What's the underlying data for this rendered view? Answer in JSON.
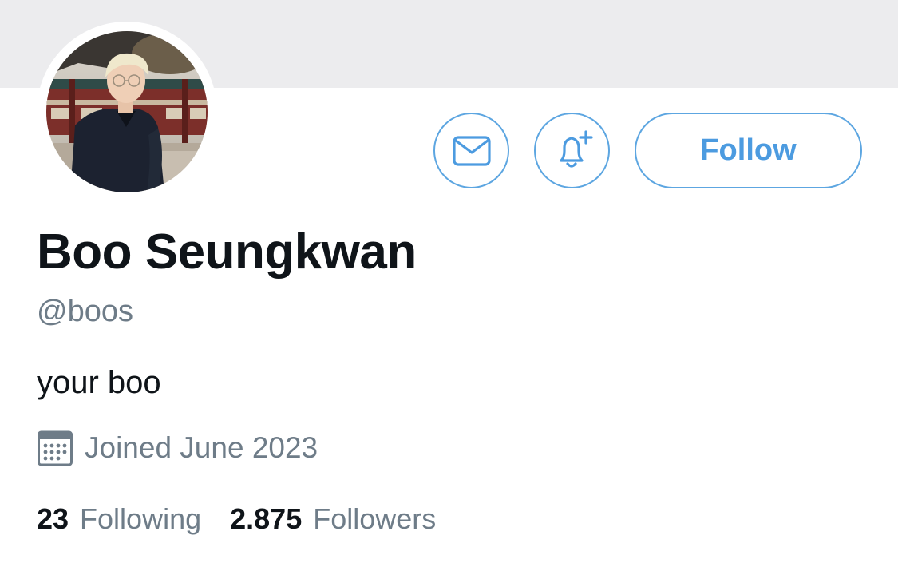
{
  "profile": {
    "display_name": "Boo Seungkwan",
    "handle": "@boos",
    "bio": "your boo",
    "joined": "Joined June 2023"
  },
  "actions": {
    "message_icon": "envelope-icon",
    "notify_icon": "bell-plus-icon",
    "follow_label": "Follow"
  },
  "stats": {
    "following_count": "23",
    "following_label": "Following",
    "followers_count": "2.875",
    "followers_label": "Followers"
  },
  "icons": {
    "joined": "calendar-icon"
  },
  "colors": {
    "accent": "#4c9be0",
    "banner": "#ececee",
    "text_primary": "#0f1419",
    "text_secondary": "#6e7c88"
  }
}
